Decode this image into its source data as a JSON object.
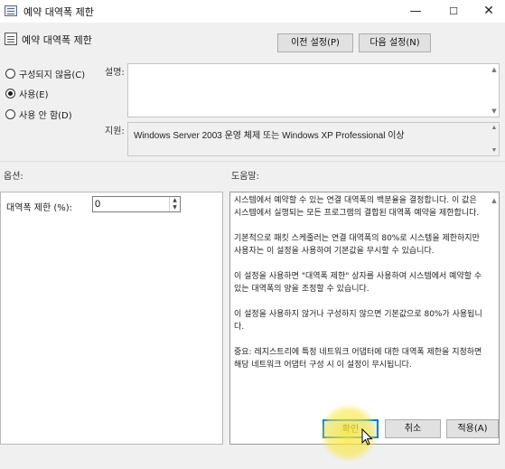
{
  "window": {
    "title": "예약 대역폭 제한",
    "controls": {
      "minimize": "—",
      "maximize": "☐",
      "close": "✕"
    },
    "app_icon": "policy-window-icon"
  },
  "header": {
    "policy_name": "예약 대역폭 제한",
    "policy_icon": "policy-setting-icon",
    "prev_button": "이전 설정(P)",
    "next_button": "다음 설정(N)"
  },
  "state": {
    "options": [
      {
        "label": "구성되지 않음(C)",
        "checked": false
      },
      {
        "label": "사용(E)",
        "checked": true
      },
      {
        "label": "사용 안 함(D)",
        "checked": false
      }
    ]
  },
  "comment": {
    "label": "설명:",
    "value": ""
  },
  "supported": {
    "label": "지원:",
    "value": "Windows Server 2003 운영 체제 또는 Windows XP Professional 이상"
  },
  "options_section": {
    "label": "옵션:",
    "limit_label": "대역폭 제한 (%):",
    "limit_value": "0"
  },
  "help_section": {
    "label": "도움말:",
    "paragraphs": [
      "시스템에서 예약할 수 있는 연결 대역폭의 백분율을 결정합니다. 이 값은 시스템에서 실행되는 모든 프로그램의 결합된 대역폭 예약을 제한합니다.",
      "기본적으로 패킷 스케줄러는 연결 대역폭의 80%로 시스템을 제한하지만 사용자는 이 설정을 사용하여 기본값을 무시할 수 있습니다.",
      "이 설정을 사용하면 \"대역폭 제한\" 상자를 사용하여 시스템에서 예약할 수 있는 대역폭의 양을 조정할 수 있습니다.",
      "이 설정을 사용하지 않거나 구성하지 않으면 기본값으로 80%가 사용됩니다.",
      "중요: 레지스트리에 특정 네트워크 어댑터에 대한 대역폭 제한을 지정하면 해당 네트워크 어댑터 구성 시 이 설정이 무시됩니다."
    ]
  },
  "footer": {
    "ok_button": "확인",
    "cancel_button": "취소",
    "apply_button": "적용(A)"
  },
  "colors": {
    "accent": "#0078d7",
    "highlight": "#fae63c"
  }
}
